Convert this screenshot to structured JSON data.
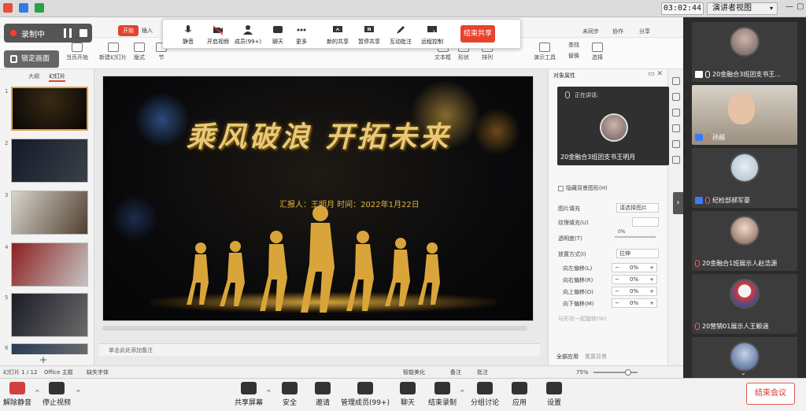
{
  "colors": {
    "accent": "#e0452f",
    "record_dot": "#ff3b30",
    "gold": "#e8c979",
    "host_badge": "#3d7bf5"
  },
  "system_bar": {
    "timer": "03:02:44",
    "view_mode": "演讲者视图"
  },
  "recording": {
    "label": "录制中",
    "lock_label": "锁定画面"
  },
  "ribbon": {
    "tab_start": "开始",
    "tab_insert": "插入",
    "sync_label": "未同步",
    "collab_label": "协作",
    "share_label": "分享",
    "buttons": [
      "当页开始",
      "新建幻灯片",
      "版式",
      "节",
      "文本框",
      "形状",
      "排列",
      "演示工具",
      "替换",
      "选择",
      "查找"
    ]
  },
  "share_toolbar": {
    "buttons": [
      "静音",
      "开启视频",
      "成员(99+)",
      "聊天",
      "更多",
      "新的共享",
      "暂停共享",
      "互动批注",
      "远程控制"
    ],
    "end_share": "结束共享"
  },
  "slide_pane": {
    "tabs": [
      "大纲",
      "幻灯片"
    ],
    "slides": [
      "1",
      "2",
      "3",
      "4",
      "5",
      "6"
    ],
    "add_icon": "+"
  },
  "slide": {
    "title": "乘风破浪 开拓未来",
    "subtitle": "汇报人：王明月   时间：2022年1月22日",
    "notes_placeholder": "单击此处添加备注"
  },
  "properties": {
    "header": "对象属性",
    "hide_bg": "隐藏背景图形(H)",
    "fill_label": "图片填充",
    "fill_value": "请选择图片",
    "texture_label": "纹理填充(U)",
    "transparency_label": "透明度(T)",
    "transparency_value": "0%",
    "place_label": "放置方式(I)",
    "place_value": "拉伸",
    "offsets": [
      {
        "label": "向左偏移(L)",
        "value": "0%"
      },
      {
        "label": "向右偏移(R)",
        "value": "0%"
      },
      {
        "label": "向上偏移(O)",
        "value": "0%"
      },
      {
        "label": "向下偏移(M)",
        "value": "0%"
      }
    ],
    "rotate_with": "与形状一起旋转(W)",
    "apply_all": "全部应用",
    "reset_bg": "重置背景"
  },
  "speaking_popup": {
    "label": "正在讲话:",
    "name": "20金融合3班团支书王明月"
  },
  "status_bar": {
    "slide_count": "幻灯片 1 / 12",
    "theme": "Office 主题",
    "missing_font": "缺失字体",
    "beautify": "智能美化",
    "notes": "备注",
    "comments": "批注",
    "zoom": "75%"
  },
  "participants": [
    {
      "name": "20金融合3班团支书王...",
      "badge": "share",
      "mic": "on"
    },
    {
      "name": "孙越",
      "badge": "host",
      "mic": "muted"
    },
    {
      "name": "纪检部郝军豪",
      "badge": "host",
      "mic": "muted"
    },
    {
      "name": "20金融合1班展示人赵浩源",
      "badge": "",
      "mic": "muted"
    },
    {
      "name": "20营销01展示人王颖涵",
      "badge": "",
      "mic": "muted"
    },
    {
      "name": "",
      "badge": "",
      "mic": "muted"
    }
  ],
  "meeting_bar": {
    "unmute": "解除静音",
    "stop_video": "停止视频",
    "share_screen": "共享屏幕",
    "security": "安全",
    "invite": "邀请",
    "manage_members": "管理成员(99+)",
    "chat": "聊天",
    "end_record": "结束录制",
    "breakout": "分组讨论",
    "apps": "应用",
    "settings": "设置",
    "end_meeting": "结束会议"
  }
}
